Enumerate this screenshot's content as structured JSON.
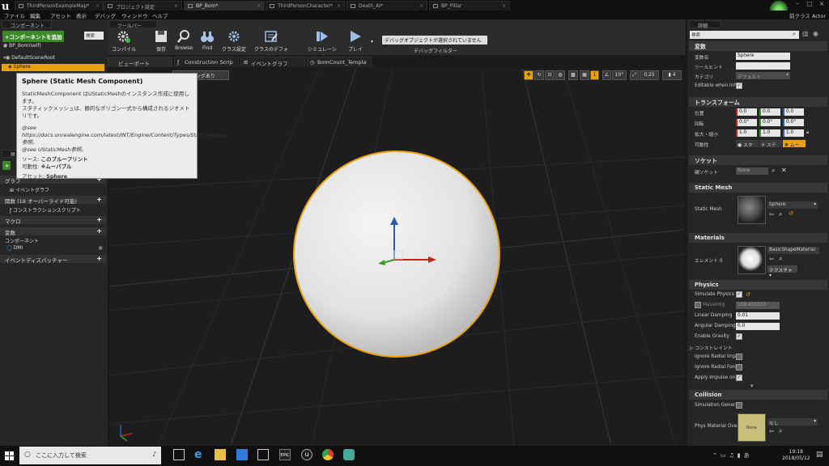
{
  "titlebar": {
    "tabs": [
      {
        "label": "ThirdPersonExampleMap*"
      },
      {
        "label": "プロジェクト設定"
      },
      {
        "label": "BP_Bom*"
      },
      {
        "label": "ThirdPersonCharacter*"
      },
      {
        "label": "Death_AI*"
      },
      {
        "label": "BP_Pillar"
      }
    ],
    "user_label": "前クラス Actor"
  },
  "menubar": {
    "items": [
      "ファイル",
      "編集",
      "アセット",
      "表示",
      "デバッグ",
      "ウィンドウ",
      "ヘルプ"
    ]
  },
  "components_panel": {
    "header": "コンポーネント",
    "add_button": "+コンポーネントを追加",
    "search_placeholder": "検索",
    "self_item": "BP_Bom(self)",
    "tree": [
      "DefaultSceneRoot",
      "Sphere"
    ]
  },
  "tooltip": {
    "title": "Sphere (Static Mesh Component)",
    "line1": "StaticMeshComponent はUStaticMeshのインスタンス作成に使用します。",
    "line2": "スタティックメッシュは、静的なポリゴン一式から構成されるジオメトリです。",
    "line3": "@see https://docs.unrealengine.com/latest/INT/Engine/Content/Types/StaticMeshes/参照。",
    "line4": "@see UStaticMesh参照。",
    "source_label": "ソース:",
    "source_value": "このブループリント",
    "mobility_label": "可動性:",
    "mobility_value": "ムーバブル",
    "asset_label": "アセット:",
    "asset_value": "Sphere"
  },
  "mybp_panel": {
    "sections": [
      {
        "label": "グラフ"
      },
      {
        "label": "イベントグラフ",
        "sub": true
      },
      {
        "label": "関数 (18 オーバーライド可能)"
      },
      {
        "label": "コンストラクションスクリプト",
        "sub": true
      },
      {
        "label": "マクロ"
      },
      {
        "label": "変数"
      },
      {
        "label": "コンポーネント",
        "sub": true
      },
      {
        "label": "DMI",
        "sub": true
      },
      {
        "label": "イベントディスパッチャー"
      }
    ]
  },
  "toolbar": {
    "title": "ツールバー",
    "buttons": [
      "コンパイル",
      "保存",
      "Browse",
      "Find",
      "クラス設定",
      "クラスのデフォルト",
      "シミュレーション",
      "プレイ"
    ],
    "debug_select": "デバッグオブジェクトが選択されていません",
    "debug_filter": "デバッグフィルター"
  },
  "viewport_tabs": [
    "ビューポート",
    "Construction Scrip",
    "イベントグラフ",
    "BomCount_Templa"
  ],
  "viewport": {
    "partial_label": "ティングあり",
    "snap_grid": "1",
    "snap_angle": "10°",
    "snap_scale": "0.25",
    "camera_speed": "4"
  },
  "details_panel": {
    "header": "詳細",
    "search_placeholder": "検索",
    "variable": {
      "title": "変数",
      "name_label": "変数名",
      "name_value": "Sphere",
      "tooltip_label": "ツールヒント",
      "tooltip_value": "",
      "category_label": "カテゴリ",
      "category_value": "デフォルト",
      "editable_label": "Editable when Inhe"
    },
    "transform": {
      "title": "トランスフォーム",
      "location_label": "位置",
      "location": [
        "0.0",
        "0.0",
        "0.0"
      ],
      "rotation_label": "回転",
      "rotation": [
        "0.0°",
        "0.0°",
        "0.0°"
      ],
      "scale_label": "拡大・縮小",
      "scale": [
        "1.0",
        "1.0",
        "1.0"
      ],
      "mobility_label": "可動性",
      "mobility_options": [
        "スタ",
        "ステ",
        "ムー"
      ]
    },
    "socket": {
      "title": "ソケット",
      "parent_label": "親ソケット",
      "parent_value": "None"
    },
    "static_mesh": {
      "title": "Static Mesh",
      "label": "Static Mesh",
      "value": "Sphere"
    },
    "materials": {
      "title": "Materials",
      "element_label": "エレメント 0",
      "value": "BasicShapeMaterial",
      "texture_btn": "テクスチャ"
    },
    "physics": {
      "title": "Physics",
      "simulate_label": "Simulate Physics",
      "mass_label": "MassInKg",
      "mass_value": "109.456337",
      "linear_label": "Linear Damping",
      "linear_value": "0.01",
      "angular_label": "Angular Damping",
      "angular_value": "0.0",
      "gravity_label": "Enable Gravity",
      "constraint_label": "コンストレイント",
      "ignore_impulse_label": "Ignore Radial Impu",
      "ignore_force_label": "Ignore Radial Forc",
      "apply_impulse_label": "Apply Impulse on I"
    },
    "collision": {
      "title": "Collision",
      "sim_gen_label": "Simulation Genera",
      "phys_mat_label": "Phys Material Ove",
      "phys_mat_value": "なし",
      "phys_mat_thumb": "None"
    }
  },
  "taskbar": {
    "search_placeholder": "ここに入力して検索",
    "time": "19:18",
    "date": "2018/05/12"
  },
  "colors": {
    "accent_green": "#3b8a27",
    "selection_orange": "#e8a20f",
    "axis_x": "#b52c1f",
    "axis_y": "#3c9a2e",
    "axis_z": "#2c5ea8"
  }
}
